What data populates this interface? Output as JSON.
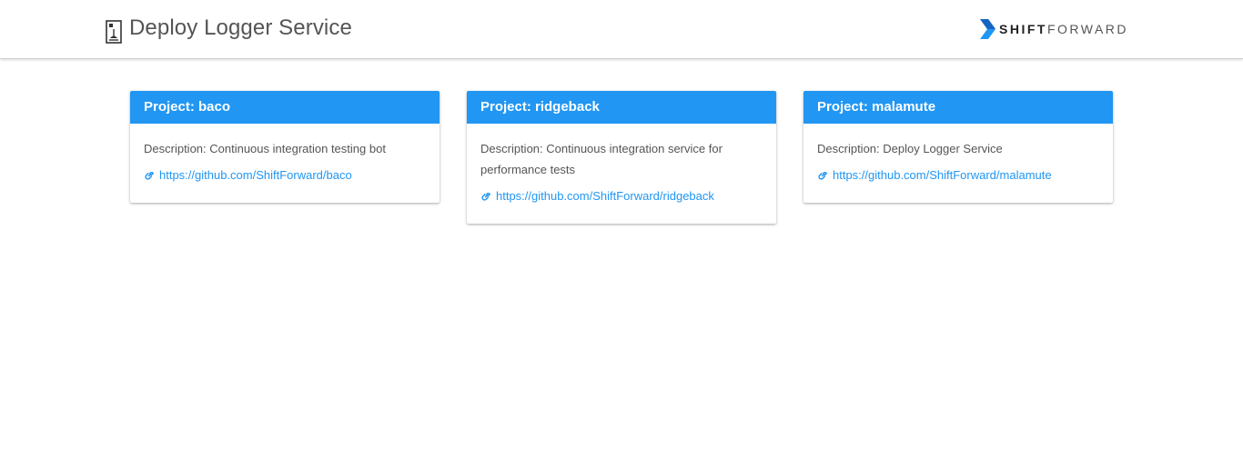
{
  "header": {
    "title": "Deploy Logger Service",
    "icon": "document-icon",
    "logo": {
      "bold": "SHIFT",
      "light": "FORWARD",
      "mark_color": "#2196f3"
    }
  },
  "colors": {
    "accent": "#2196f3",
    "text": "#555555"
  },
  "projects": [
    {
      "header": "Project: baco",
      "description": "Description: Continuous integration testing bot",
      "url": "https://github.com/ShiftForward/baco"
    },
    {
      "header": "Project: ridgeback",
      "description": "Description: Continuous integration service for performance tests",
      "url": "https://github.com/ShiftForward/ridgeback"
    },
    {
      "header": "Project: malamute",
      "description": "Description: Deploy Logger Service",
      "url": "https://github.com/ShiftForward/malamute"
    }
  ]
}
